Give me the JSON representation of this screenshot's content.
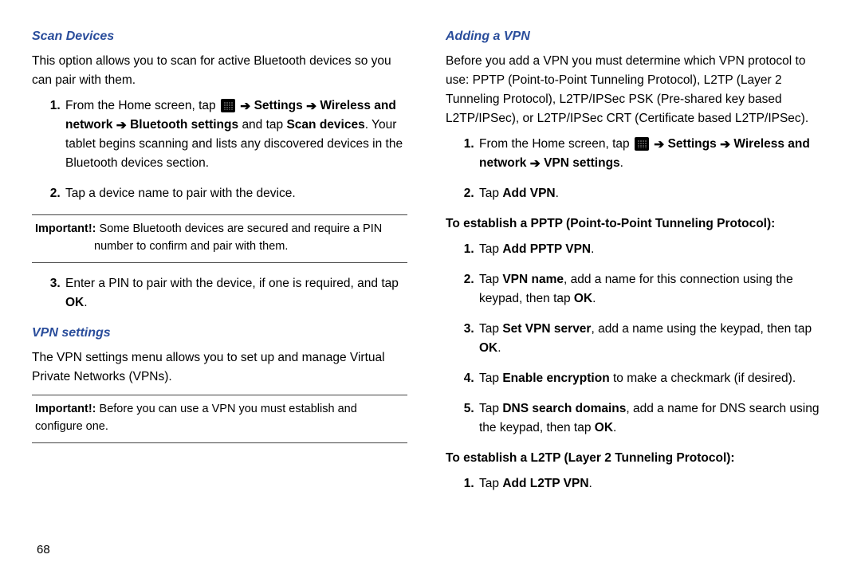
{
  "page_number": "68",
  "left": {
    "h1": "Scan Devices",
    "intro": "This option allows you to scan for active Bluetooth devices so you can pair with them.",
    "step1_pre": "From the Home screen, tap ",
    "step1_mid_settings": "Settings",
    "step1_mid_wireless": "Wireless and network",
    "step1_mid_bt": "Bluetooth settings",
    "step1_mid_scan": "Scan devices",
    "step1_post": ". Your tablet begins scanning and lists any discovered devices in the Bluetooth devices section.",
    "step2": "Tap a device name to pair with the device.",
    "note1_label": "Important!:",
    "note1_text": "Some Bluetooth devices are secured and require a PIN number to confirm and pair with them.",
    "step3_pre": "Enter a PIN to pair with the device, if one is required, and tap ",
    "step3_ok": "OK",
    "step3_post": ".",
    "h2": "VPN settings",
    "vpn_intro": "The VPN settings menu allows you to set up and manage Virtual Private Networks (VPNs).",
    "note2_label": "Important!:",
    "note2_text": "Before you can use a VPN you must establish and configure one."
  },
  "right": {
    "h1": "Adding a VPN",
    "intro": "Before you add a VPN you must determine which VPN protocol to use: PPTP (Point-to-Point Tunneling Protocol), L2TP (Layer 2 Tunneling Protocol), L2TP/IPSec PSK (Pre-shared key based L2TP/IPSec), or L2TP/IPSec CRT (Certificate based L2TP/IPSec).",
    "step1_pre": "From the Home screen, tap ",
    "step1_settings": "Settings",
    "step1_wireless": "Wireless and network",
    "step1_vpn": "VPN settings",
    "step1_post": ".",
    "step2_pre": "Tap ",
    "step2_addvpn": "Add VPN",
    "step2_post": ".",
    "sub1": "To establish a PPTP (Point-to-Point Tunneling Protocol):",
    "pptp1_pre": "Tap ",
    "pptp1_add": "Add PPTP VPN",
    "pptp1_post": ".",
    "pptp2_a": "Tap ",
    "pptp2_b": "VPN name",
    "pptp2_c": ", add a name for this connection using the keypad, then tap ",
    "pptp2_d": "OK",
    "pptp2_e": ".",
    "pptp3_a": "Tap ",
    "pptp3_b": "Set VPN server",
    "pptp3_c": ", add a name using the keypad, then tap ",
    "pptp3_d": "OK",
    "pptp3_e": ".",
    "pptp4_a": "Tap ",
    "pptp4_b": "Enable encryption",
    "pptp4_c": " to make a checkmark (if desired).",
    "pptp5_a": "Tap ",
    "pptp5_b": "DNS search domains",
    "pptp5_c": ", add a name for DNS search using the keypad, then tap ",
    "pptp5_d": "OK",
    "pptp5_e": ".",
    "sub2": "To establish a L2TP (Layer 2 Tunneling Protocol):",
    "l2tp1_a": "Tap ",
    "l2tp1_b": "Add L2TP VPN",
    "l2tp1_c": "."
  }
}
